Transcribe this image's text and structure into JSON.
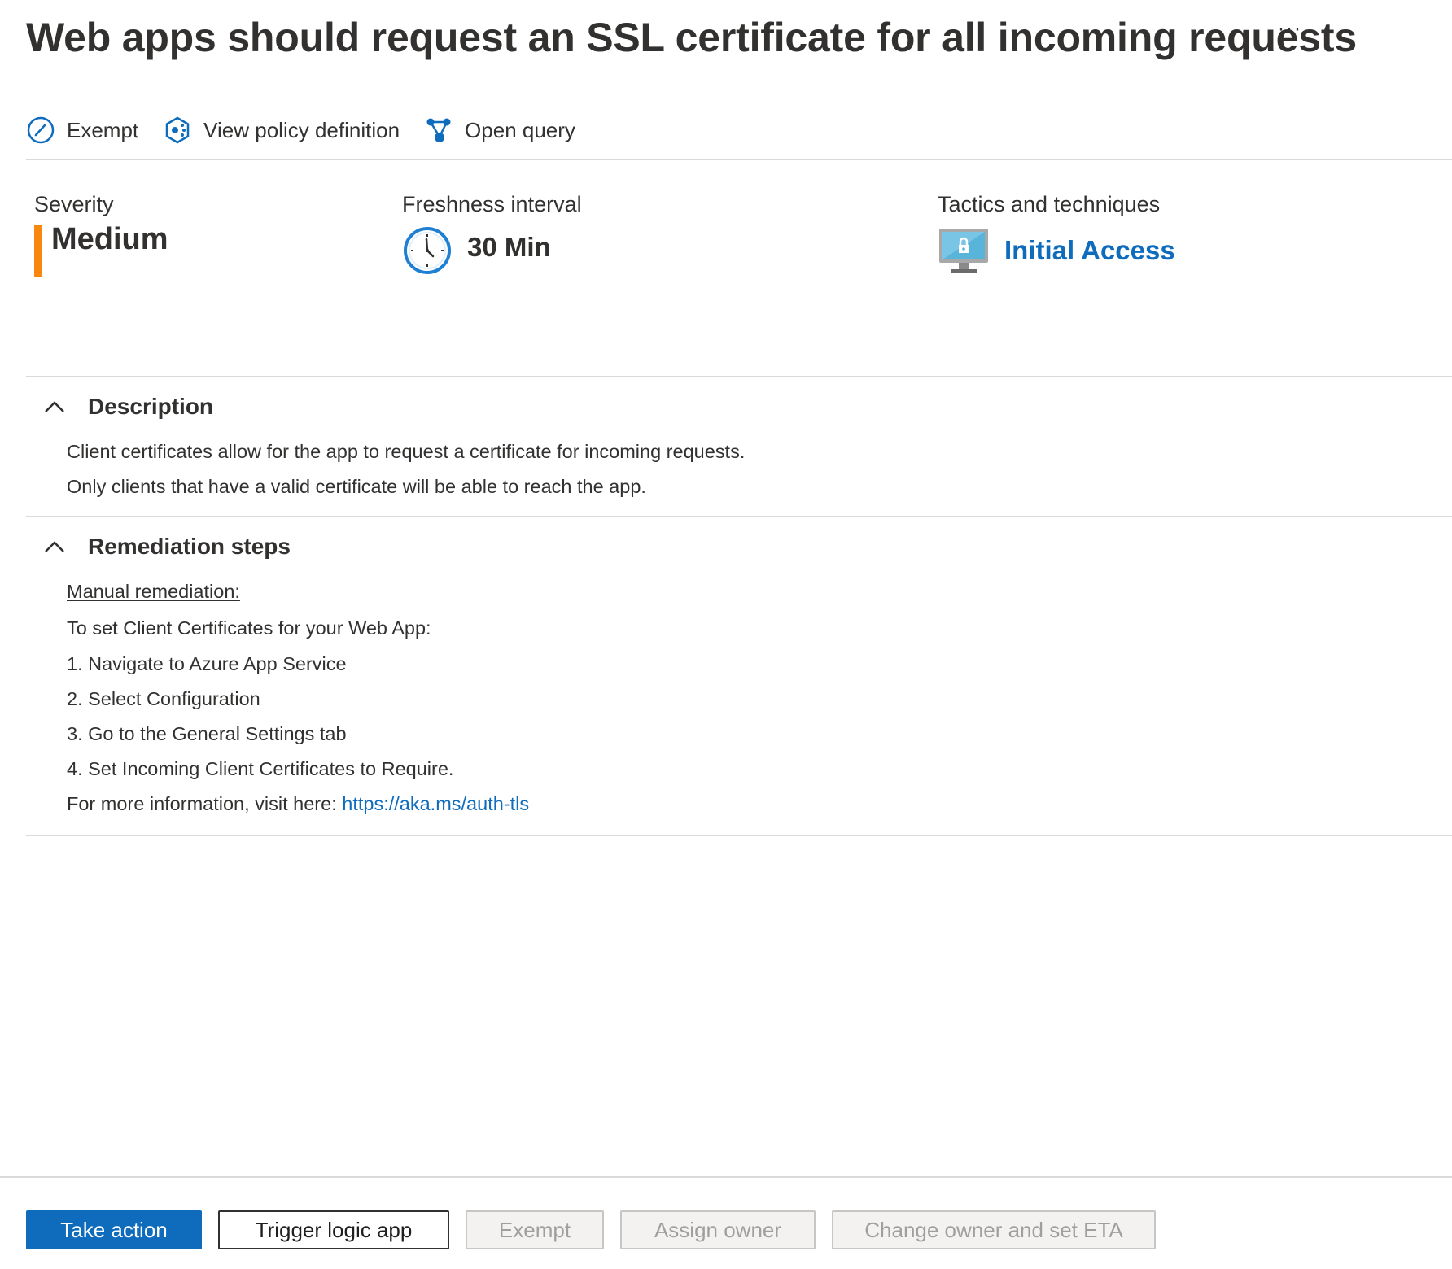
{
  "header": {
    "title": "Web apps should request an SSL certificate for all incoming requests",
    "more": "···"
  },
  "toolbar": {
    "exempt": "Exempt",
    "view_policy": "View policy definition",
    "open_query": "Open query"
  },
  "summary": {
    "severity_label": "Severity",
    "severity_value": "Medium",
    "freshness_label": "Freshness interval",
    "freshness_value": "30 Min",
    "tactics_label": "Tactics and techniques",
    "tactics_value": "Initial Access"
  },
  "colors": {
    "accent": "#0f6cbd",
    "severity_medium": "#f7870f"
  },
  "description": {
    "title": "Description",
    "lines": [
      "Client certificates allow for the app to request a certificate for incoming requests.",
      "Only clients that have a valid certificate will be able to reach the app."
    ]
  },
  "remediation": {
    "title": "Remediation steps",
    "manual_label": "Manual remediation:",
    "intro": "To set Client Certificates for your Web App:",
    "steps": [
      "1. Navigate to Azure App Service",
      "2. Select Configuration",
      "3. Go to the General Settings tab",
      "4. Set Incoming Client Certificates to Require."
    ],
    "more_info_prefix": "For more information, visit here: ",
    "more_info_link": "https://aka.ms/auth-tls"
  },
  "footer": {
    "take_action": "Take action",
    "trigger_logic_app": "Trigger logic app",
    "exempt": "Exempt",
    "assign_owner": "Assign owner",
    "change_owner": "Change owner and set ETA"
  }
}
